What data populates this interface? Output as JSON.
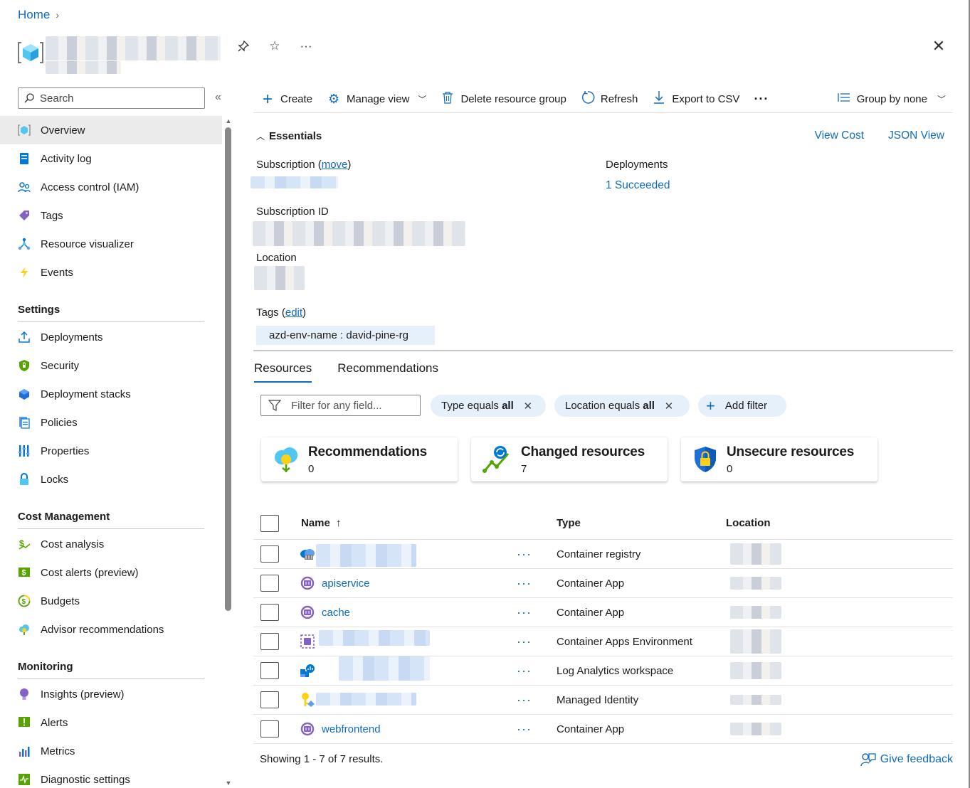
{
  "breadcrumb": {
    "home": "Home",
    "separator": "›"
  },
  "title": {
    "actions": {
      "pin": "pin-icon",
      "favorite": "star-icon",
      "more": "···"
    },
    "close": "✕"
  },
  "search": {
    "placeholder": "Search"
  },
  "collapse_label": "«",
  "sidebar": {
    "top_items": [
      {
        "label": "Overview",
        "icon": "resource-group-icon",
        "active": true
      },
      {
        "label": "Activity log",
        "icon": "activity-log-icon"
      },
      {
        "label": "Access control (IAM)",
        "icon": "iam-icon"
      },
      {
        "label": "Tags",
        "icon": "tag-icon"
      },
      {
        "label": "Resource visualizer",
        "icon": "visualizer-icon"
      },
      {
        "label": "Events",
        "icon": "lightning-icon"
      }
    ],
    "settings": {
      "heading": "Settings",
      "items": [
        {
          "label": "Deployments",
          "icon": "upload-icon"
        },
        {
          "label": "Security",
          "icon": "shield-icon"
        },
        {
          "label": "Deployment stacks",
          "icon": "stack-icon"
        },
        {
          "label": "Policies",
          "icon": "policy-icon"
        },
        {
          "label": "Properties",
          "icon": "properties-icon"
        },
        {
          "label": "Locks",
          "icon": "lock-icon"
        }
      ]
    },
    "cost": {
      "heading": "Cost Management",
      "items": [
        {
          "label": "Cost analysis",
          "icon": "cost-analysis-icon"
        },
        {
          "label": "Cost alerts (preview)",
          "icon": "cost-alert-icon"
        },
        {
          "label": "Budgets",
          "icon": "budget-icon"
        },
        {
          "label": "Advisor recommendations",
          "icon": "advisor-icon"
        }
      ]
    },
    "monitoring": {
      "heading": "Monitoring",
      "items": [
        {
          "label": "Insights (preview)",
          "icon": "insights-icon"
        },
        {
          "label": "Alerts",
          "icon": "alert-icon"
        },
        {
          "label": "Metrics",
          "icon": "metrics-icon"
        },
        {
          "label": "Diagnostic settings",
          "icon": "diagnostic-icon"
        }
      ]
    }
  },
  "toolbar": {
    "create": "Create",
    "manage_view": "Manage view",
    "delete_rg": "Delete resource group",
    "refresh": "Refresh",
    "export_csv": "Export to CSV",
    "more": "···",
    "group_by": "Group by none"
  },
  "essentials": {
    "heading": "Essentials",
    "view_cost": "View Cost",
    "json_view": "JSON View",
    "subscription_label": "Subscription",
    "subscription_move": "move",
    "subscription_id_label": "Subscription ID",
    "location_label": "Location",
    "tags_label": "Tags",
    "tags_edit": "edit",
    "tag_value": "azd-env-name : david-pine-rg",
    "deployments_label": "Deployments",
    "deployments_value": "1 Succeeded"
  },
  "tabs": [
    "Resources",
    "Recommendations"
  ],
  "filters": {
    "placeholder": "Filter for any field...",
    "type_pill": {
      "prefix": "Type equals",
      "value": "all"
    },
    "location_pill": {
      "prefix": "Location equals",
      "value": "all"
    },
    "add_filter": "Add filter"
  },
  "cards": [
    {
      "title": "Recommendations",
      "value": "0",
      "icon": "advisor-cloud-icon"
    },
    {
      "title": "Changed resources",
      "value": "7",
      "icon": "change-graph-icon"
    },
    {
      "title": "Unsecure resources",
      "value": "0",
      "icon": "security-shield-icon"
    }
  ],
  "table": {
    "headers": {
      "name": "Name",
      "sort": "↑",
      "type": "Type",
      "location": "Location"
    },
    "rows": [
      {
        "name": "",
        "type": "Container registry",
        "icon": "container-registry-icon"
      },
      {
        "name": "apiservice",
        "type": "Container App",
        "icon": "container-app-icon"
      },
      {
        "name": "cache",
        "type": "Container App",
        "icon": "container-app-icon"
      },
      {
        "name": "",
        "type": "Container Apps Environment",
        "icon": "container-env-icon"
      },
      {
        "name": "",
        "type": "Log Analytics workspace",
        "icon": "log-analytics-icon"
      },
      {
        "name": "",
        "type": "Managed Identity",
        "icon": "managed-identity-icon"
      },
      {
        "name": "webfrontend",
        "type": "Container App",
        "icon": "container-app-icon"
      }
    ],
    "row_menu": "···"
  },
  "footer": {
    "showing": "Showing 1 - 7 of 7 results.",
    "feedback": "Give feedback"
  }
}
